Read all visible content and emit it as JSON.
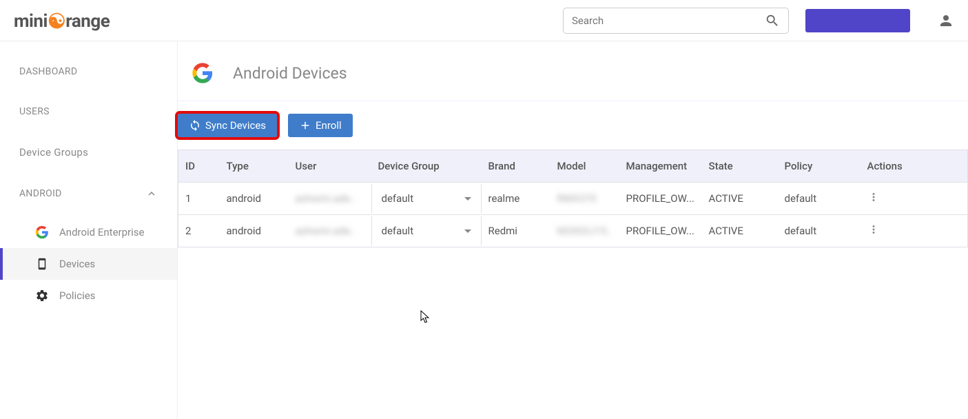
{
  "header": {
    "logo_pre": "mini",
    "logo_post": "range",
    "search_placeholder": "Search"
  },
  "sidebar": {
    "dashboard": "DASHBOARD",
    "users": "USERS",
    "device_groups": "Device Groups",
    "android": "ANDROID",
    "sub": {
      "enterprise": "Android Enterprise",
      "devices": "Devices",
      "policies": "Policies"
    }
  },
  "page": {
    "title": "Android Devices",
    "sync_button": "Sync Devices",
    "enroll_button": "Enroll"
  },
  "table": {
    "headers": {
      "id": "ID",
      "type": "Type",
      "user": "User",
      "device_group": "Device Group",
      "brand": "Brand",
      "model": "Model",
      "management": "Management",
      "state": "State",
      "policy": "Policy",
      "actions": "Actions"
    },
    "rows": [
      {
        "id": "1",
        "type": "android",
        "user": "ashwini.ade..",
        "device_group": "default",
        "brand": "realme",
        "model": "RMX370",
        "management": "PROFILE_OW...",
        "state": "ACTIVE",
        "policy": "default"
      },
      {
        "id": "2",
        "type": "android",
        "user": "ashwini.ade..",
        "device_group": "default",
        "brand": "Redmi",
        "model": "M2003J15..",
        "management": "PROFILE_OW...",
        "state": "ACTIVE",
        "policy": "default"
      }
    ]
  }
}
